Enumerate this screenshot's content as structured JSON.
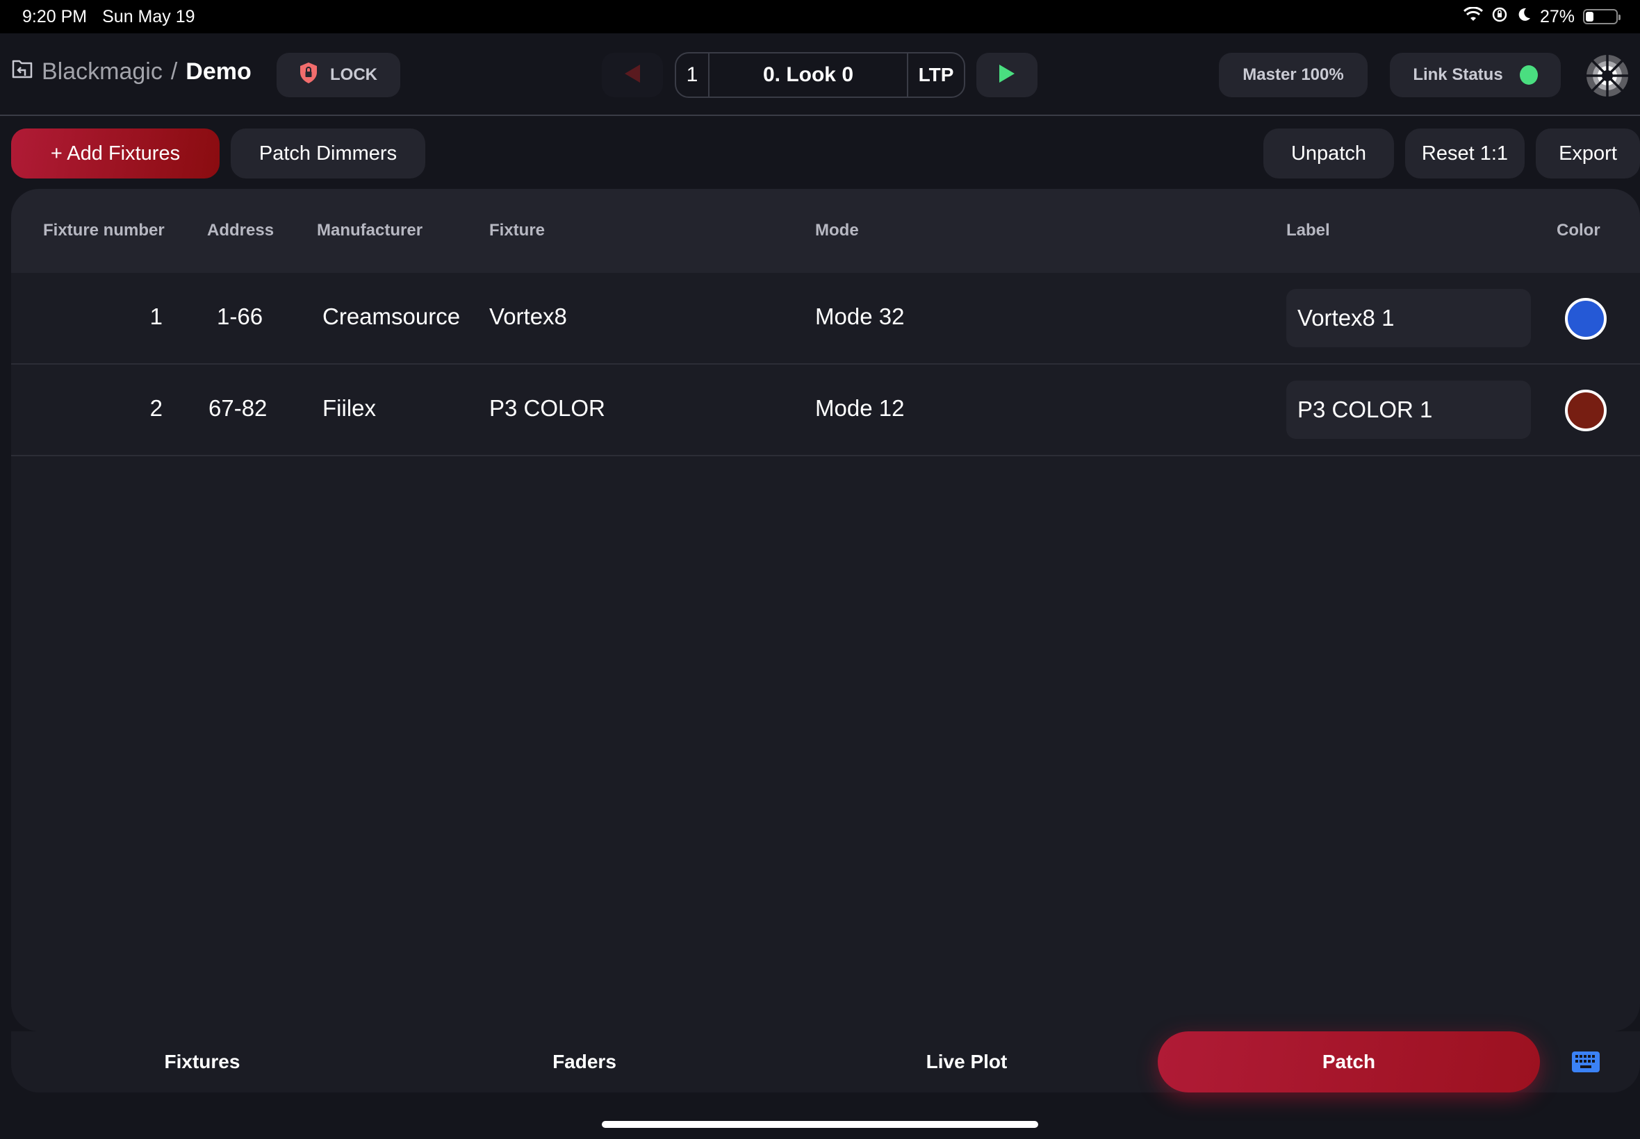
{
  "status_bar": {
    "time": "9:20 PM",
    "date": "Sun May 19",
    "battery_percent": "27%",
    "battery_level": 0.27,
    "icons": [
      "wifi-icon",
      "rotation-lock-icon",
      "moon-icon",
      "battery-icon"
    ]
  },
  "header": {
    "breadcrumb_parent": "Blackmagic",
    "breadcrumb_separator": "/",
    "breadcrumb_current": "Demo",
    "lock_label": "LOCK",
    "cue_number": "1",
    "cue_name": "0. Look 0",
    "cue_mode": "LTP",
    "master_label": "Master 100%",
    "link_status_label": "Link Status",
    "link_status_color": "#4ade80"
  },
  "toolbar": {
    "add_fixtures": "+ Add Fixtures",
    "patch_dimmers": "Patch Dimmers",
    "unpatch": "Unpatch",
    "reset": "Reset 1:1",
    "export": "Export"
  },
  "table": {
    "columns": [
      "Fixture number",
      "Address",
      "Manufacturer",
      "Fixture",
      "Mode",
      "Label",
      "Color"
    ],
    "rows": [
      {
        "fixture_number": "1",
        "address": "1-66",
        "manufacturer": "Creamsource",
        "fixture": "Vortex8",
        "mode": "Mode 32",
        "label": "Vortex8 1",
        "color": "#2559d6"
      },
      {
        "fixture_number": "2",
        "address": "67-82",
        "manufacturer": "Fiilex",
        "fixture": "P3 COLOR",
        "mode": "Mode 12",
        "label": "P3 COLOR 1",
        "color": "#771e12"
      }
    ]
  },
  "bottom_nav": {
    "items": [
      "Fixtures",
      "Faders",
      "Live Plot",
      "Patch"
    ],
    "active": "Patch"
  },
  "colors": {
    "accent": "#b01b36",
    "background": "#14151c",
    "panel": "#1b1c24"
  }
}
